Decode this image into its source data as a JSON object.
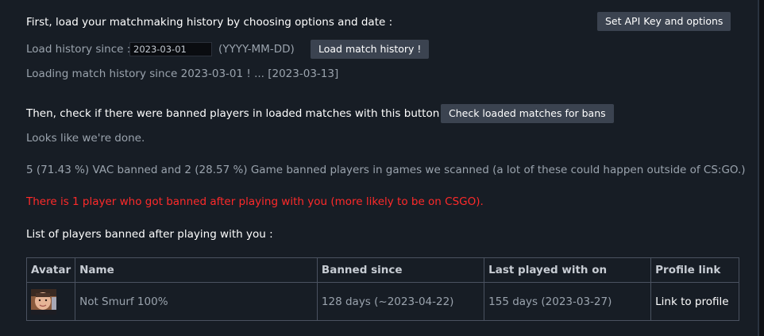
{
  "step1": {
    "heading": "First, load your matchmaking history by choosing options and date :",
    "api_button": "Set API Key and options",
    "since_label": "Load history since :",
    "date_value": "2023-03-01",
    "date_format": "(YYYY-MM-DD)",
    "load_button": "Load match history !",
    "loading_status": "Loading match history since 2023-03-01 ! ... [2023-03-13]"
  },
  "step2": {
    "heading": "Then, check if there were banned players in loaded matches with this button :",
    "check_button": "Check loaded matches for bans",
    "done_status": "Looks like we're done.",
    "summary": "5 (71.43 %) VAC banned and 2 (28.57 %) Game banned players in games we scanned (a lot of these could happen outside of CS:GO.)",
    "alert": "There is 1 player who got banned after playing with you (more likely to be on CSGO).",
    "list_heading": "List of players banned after playing with you :"
  },
  "table": {
    "headers": [
      "Avatar",
      "Name",
      "Banned since",
      "Last played with on",
      "Profile link"
    ],
    "rows": [
      {
        "name": "Not Smurf 100%",
        "banned_since": "128 days (~2023-04-22)",
        "last_played": "155 days (2023-03-27)",
        "profile_link": "Link to profile"
      }
    ]
  },
  "colors": {
    "panel_bg": "#171d25",
    "button_bg": "#3b4350",
    "alert_red": "#ff2a2a",
    "muted_text": "#9aa3ad"
  }
}
